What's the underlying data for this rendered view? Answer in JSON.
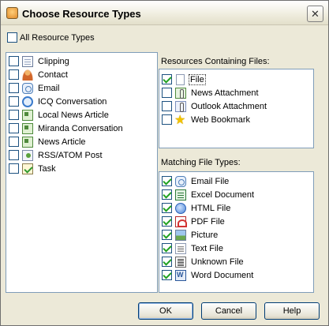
{
  "window": {
    "title": "Choose Resource Types",
    "close_glyph": "✕",
    "title_icon": "resource-types-icon"
  },
  "all_types": {
    "label": "All Resource Types",
    "checked": false
  },
  "resource_types": [
    {
      "label": "Clipping",
      "icon": "clipping-icon",
      "checked": false
    },
    {
      "label": "Contact",
      "icon": "contact-icon",
      "checked": false
    },
    {
      "label": "Email",
      "icon": "email-icon",
      "checked": false
    },
    {
      "label": "ICQ Conversation",
      "icon": "icq-icon",
      "checked": false
    },
    {
      "label": "Local News Article",
      "icon": "local-news-icon",
      "checked": false
    },
    {
      "label": "Miranda Conversation",
      "icon": "miranda-icon",
      "checked": false
    },
    {
      "label": "News Article",
      "icon": "news-article-icon",
      "checked": false
    },
    {
      "label": "RSS/ATOM Post",
      "icon": "rss-icon",
      "checked": false
    },
    {
      "label": "Task",
      "icon": "task-icon",
      "checked": false
    }
  ],
  "files_group": {
    "label": "Resources Containing Files:",
    "items": [
      {
        "label": "File",
        "icon": "file-icon",
        "checked": true,
        "selected": true
      },
      {
        "label": "News Attachment",
        "icon": "news-attachment-icon",
        "checked": false
      },
      {
        "label": "Outlook Attachment",
        "icon": "outlook-attachment-icon",
        "checked": false
      },
      {
        "label": "Web Bookmark",
        "icon": "web-bookmark-icon",
        "checked": false
      }
    ]
  },
  "file_types_group": {
    "label": "Matching File Types:",
    "items": [
      {
        "label": "Email File",
        "icon": "email-file-icon",
        "checked": true
      },
      {
        "label": "Excel Document",
        "icon": "excel-icon",
        "checked": true
      },
      {
        "label": "HTML File",
        "icon": "html-icon",
        "checked": true
      },
      {
        "label": "PDF File",
        "icon": "pdf-icon",
        "checked": true
      },
      {
        "label": "Picture",
        "icon": "picture-icon",
        "checked": true
      },
      {
        "label": "Text File",
        "icon": "text-file-icon",
        "checked": true
      },
      {
        "label": "Unknown File",
        "icon": "unknown-file-icon",
        "checked": true
      },
      {
        "label": "Word Document",
        "icon": "word-icon",
        "checked": true
      }
    ]
  },
  "buttons": {
    "ok": "OK",
    "cancel": "Cancel",
    "help": "Help"
  }
}
